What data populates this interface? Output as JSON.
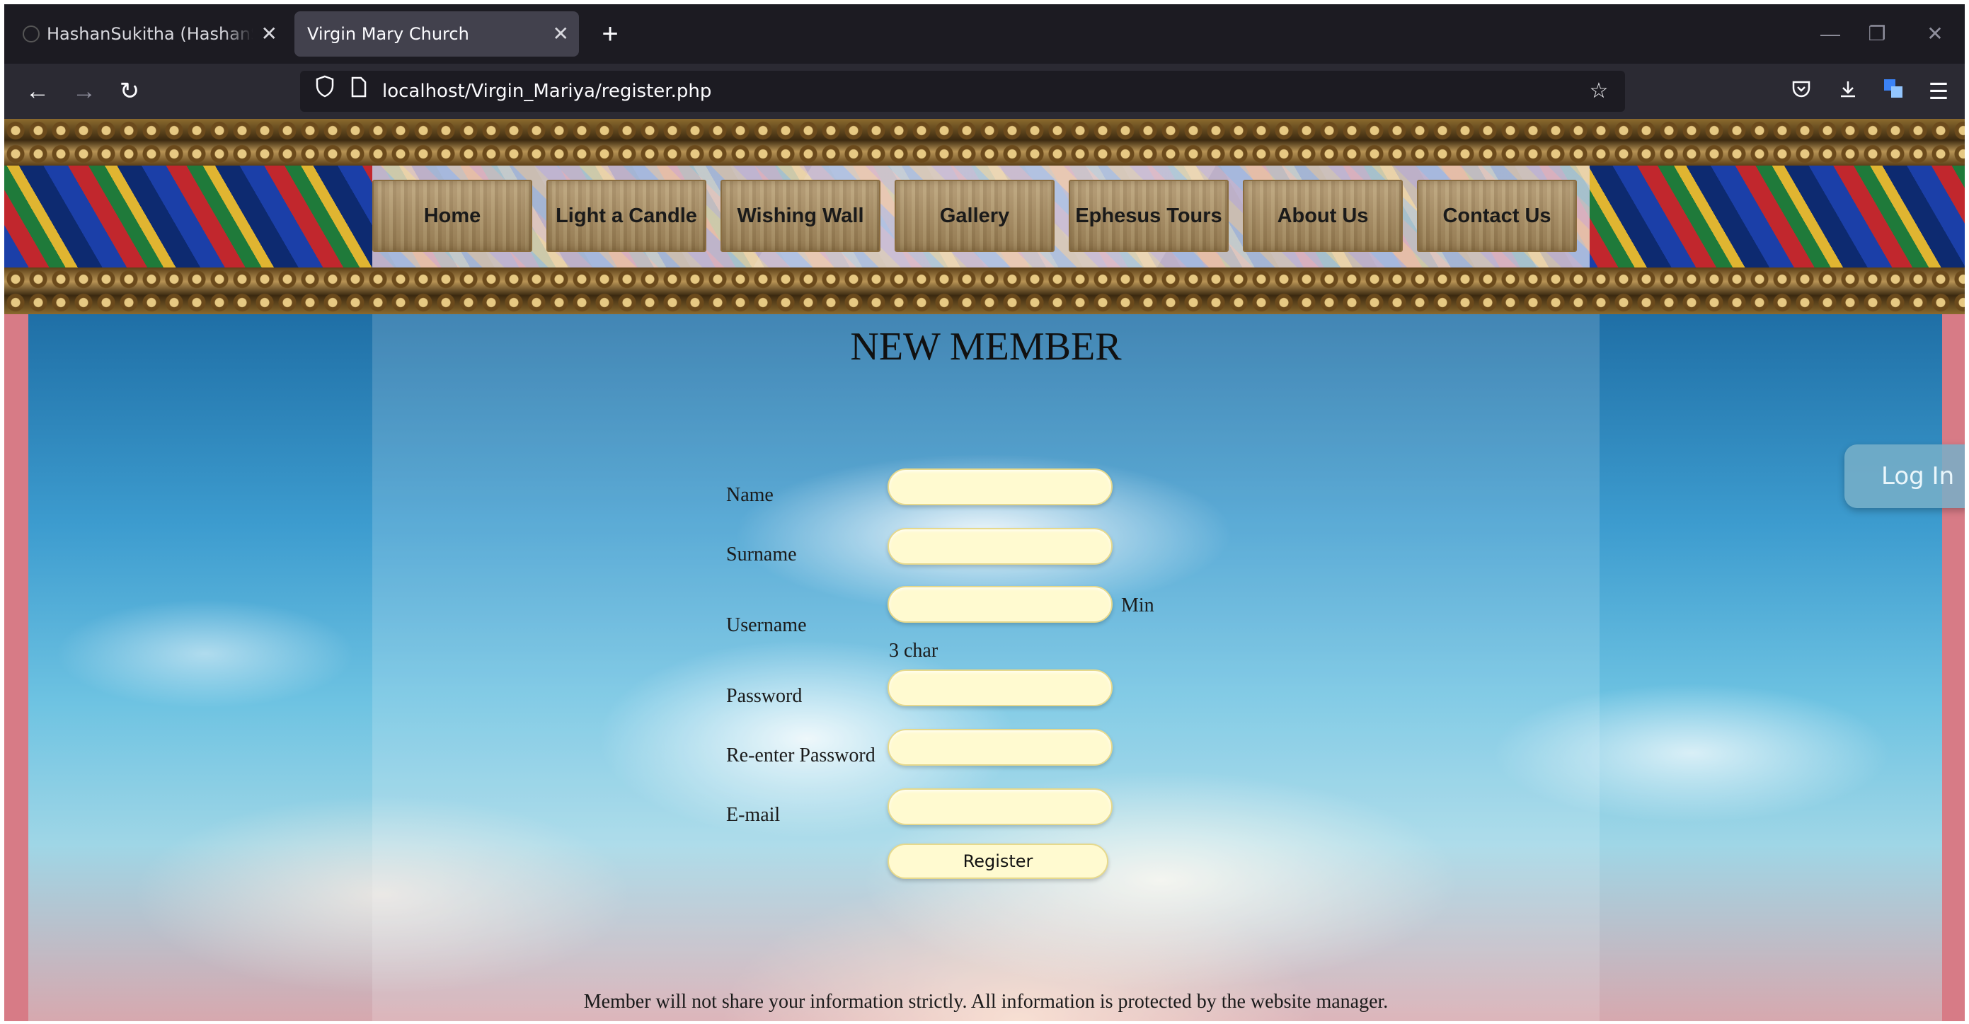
{
  "browser": {
    "tabs": [
      {
        "title": "HashanSukitha (HashanSukitha)",
        "close": "✕"
      },
      {
        "title": "Virgin Mary Church",
        "close": "✕"
      }
    ],
    "new_tab": "+",
    "url": "localhost/Virgin_Mariya/register.php"
  },
  "site": {
    "menu": [
      "Home",
      "Light a Candle",
      "Wishing Wall",
      "Gallery",
      "Ephesus Tours",
      "About Us",
      "Contact Us"
    ],
    "login_label": "Log In"
  },
  "form": {
    "heading": "NEW MEMBER",
    "fields": {
      "name": "Name",
      "surname": "Surname",
      "username": "Username",
      "password": "Password",
      "repassword": "Re-enter Password",
      "email": "E-mail"
    },
    "username_hint_1": "Min",
    "username_hint_2": "3 char",
    "register_label": "Register"
  },
  "footer": {
    "note": "Member will not share your information strictly. All information is protected by the website manager."
  },
  "icons": [
    "back-icon",
    "forward-icon",
    "reload-icon",
    "shield-icon",
    "page-icon",
    "star-icon",
    "pocket-icon",
    "download-icon",
    "translate-icon",
    "menu-icon"
  ]
}
